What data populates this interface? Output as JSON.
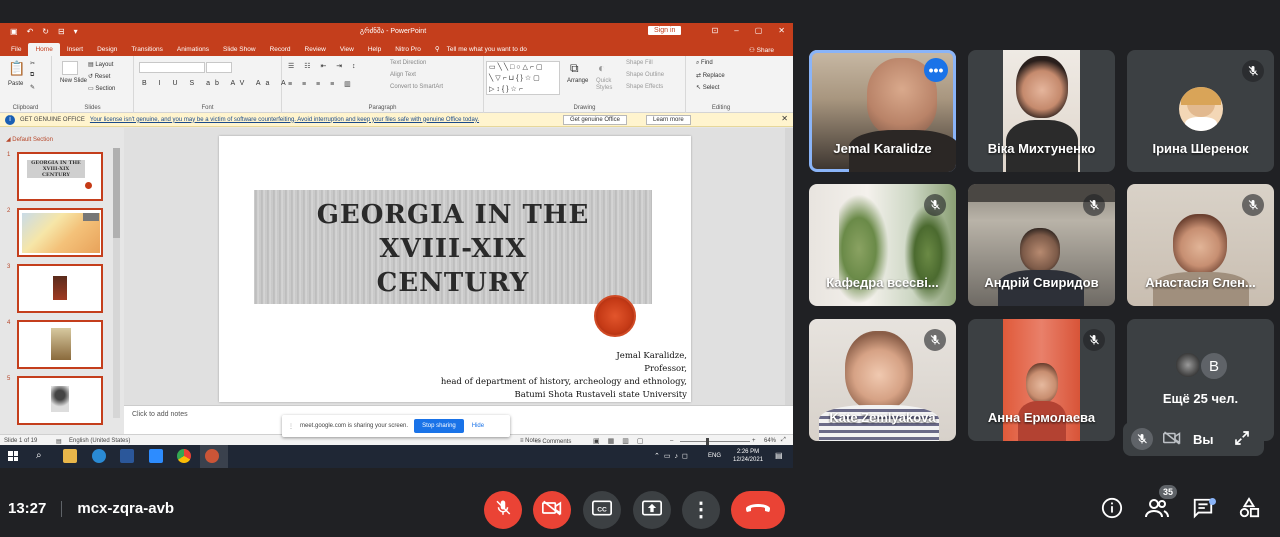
{
  "meeting": {
    "time": "13:27",
    "code": "mcx-zqra-avb",
    "participant_count": "35"
  },
  "ppt": {
    "doc_title": "გრძნშა - PowerPoint",
    "sign_in": "Sign in",
    "menu_tabs": [
      "File",
      "Home",
      "Insert",
      "Design",
      "Transitions",
      "Animations",
      "Slide Show",
      "Record",
      "Review",
      "View",
      "Help",
      "Nitro Pro"
    ],
    "tell_me": "Tell me what you want to do",
    "share": "Share",
    "ribbon": {
      "paste": "Paste",
      "clipboard": "Clipboard",
      "new_slide": "New Slide",
      "layout": "Layout",
      "reset": "Reset",
      "section": "Section",
      "slides": "Slides",
      "font": "Font",
      "paragraph": "Paragraph",
      "text_direction": "Text Direction",
      "align_text": "Align Text",
      "convert_smartart": "Convert to SmartArt",
      "arrange": "Arrange",
      "quick_styles": "Quick Styles",
      "shape_fill": "Shape Fill",
      "shape_outline": "Shape Outline",
      "shape_effects": "Shape Effects",
      "drawing": "Drawing",
      "find": "Find",
      "replace": "Replace",
      "select": "Select",
      "editing": "Editing"
    },
    "warning": {
      "title": "GET GENUINE OFFICE",
      "message": "Your license isn't genuine, and you may be a victim of software counterfeiting. Avoid interruption and keep your files safe with genuine Office today.",
      "get_btn": "Get genuine Office",
      "learn_btn": "Learn more"
    },
    "section_name": "Default Section",
    "thumb_numbers": [
      "1",
      "2",
      "3",
      "4",
      "5"
    ],
    "slide": {
      "title_line1": "GEORGIA   IN THE",
      "title_line2": "XVIII-XIX",
      "title_line3": "CENTURY",
      "author": "Jemal Karalidze,",
      "role": "Professor,",
      "position": "head of department of history, archeology and ethnology,",
      "university": "Batumi Shota Rustaveli state University"
    },
    "notes_placeholder": "Click to add notes",
    "status": {
      "slide_of": "Slide 1 of 19",
      "language": "English (United States)",
      "notes": "Notes",
      "comments": "Comments",
      "zoom": "64%"
    },
    "sharebar": {
      "text": "meet.google.com is sharing your screen.",
      "stop": "Stop sharing",
      "hide": "Hide"
    },
    "taskbar": {
      "lang": "ENG",
      "time": "2:26 PM",
      "date": "12/24/2021"
    }
  },
  "tiles": [
    {
      "name": "Jemal Karalidze"
    },
    {
      "name": "Віка Михтуненко"
    },
    {
      "name": "Ірина Шеренок"
    },
    {
      "name": "Кафедра всесві..."
    },
    {
      "name": "Андрій Свиридов"
    },
    {
      "name": "Анастасія Єлен..."
    },
    {
      "name": "Kate Zemlyakova"
    },
    {
      "name": "Анна Ермолаева"
    }
  ],
  "more_tile": {
    "avatar_letter": "В",
    "text": "Ещё 25 чел."
  },
  "self_view": {
    "label": "Вы"
  },
  "colors": {
    "meet_bg": "#202124",
    "tile_bg": "#3c4043",
    "danger": "#ea4335",
    "accent": "#1a73e8",
    "ppt_red": "#c43e1c"
  }
}
